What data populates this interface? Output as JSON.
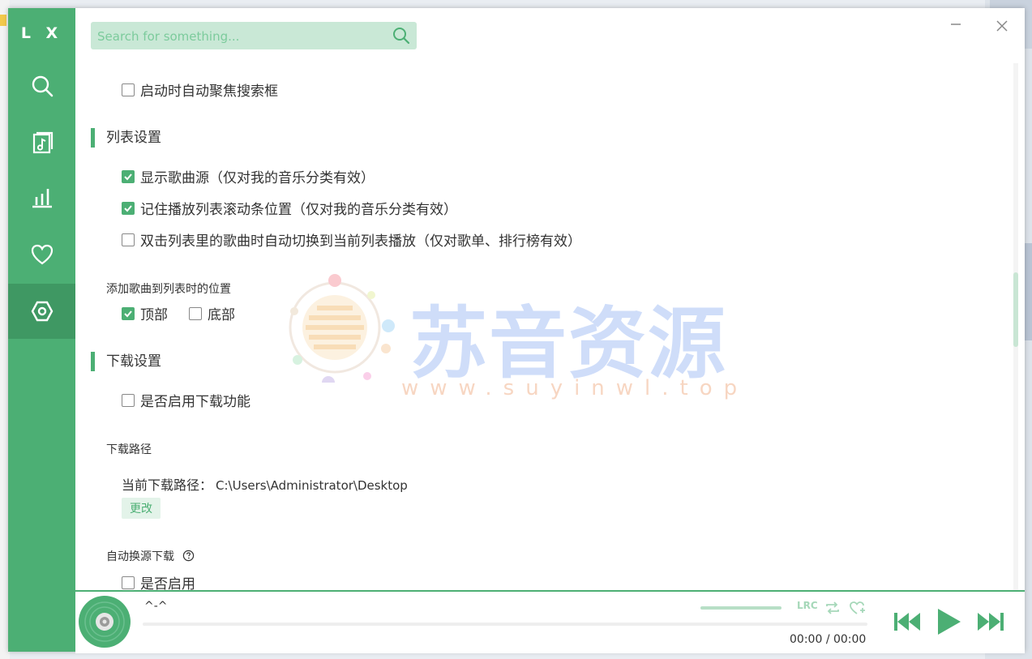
{
  "app": {
    "logo": "L X"
  },
  "sidebar": {
    "items": [
      {
        "name": "search",
        "icon": "search-icon"
      },
      {
        "name": "songlist",
        "icon": "music-file-icon"
      },
      {
        "name": "leaderboard",
        "icon": "bar-chart-icon"
      },
      {
        "name": "my-music",
        "icon": "heart-icon"
      },
      {
        "name": "settings",
        "icon": "hexagon-settings-icon",
        "active": true
      }
    ]
  },
  "search": {
    "placeholder": "Search for something..."
  },
  "settings": {
    "autofocus_search": {
      "label": "启动时自动聚焦搜索框",
      "checked": false
    },
    "list_section_title": "列表设置",
    "list_options": [
      {
        "label": "显示歌曲源（仅对我的音乐分类有效）",
        "checked": true
      },
      {
        "label": "记住播放列表滚动条位置（仅对我的音乐分类有效）",
        "checked": true
      },
      {
        "label": "双击列表里的歌曲时自动切换到当前列表播放（仅对歌单、排行榜有效）",
        "checked": false
      }
    ],
    "add_position_title": "添加歌曲到列表时的位置",
    "add_position_options": [
      {
        "label": "顶部",
        "checked": true
      },
      {
        "label": "底部",
        "checked": false
      }
    ],
    "download_section_title": "下载设置",
    "enable_download": {
      "label": "是否启用下载功能",
      "checked": false
    },
    "download_path_title": "下载路径",
    "current_path_label": "当前下载路径：",
    "current_path_value": "C:\\Users\\Administrator\\Desktop",
    "change_button": "更改",
    "auto_switch_title": "自动换源下载",
    "auto_switch_enable": {
      "label": "是否启用",
      "checked": false
    }
  },
  "watermark": {
    "text": "苏音资源",
    "url": "www.suyinwl.top"
  },
  "player": {
    "title": "^-^",
    "time_current": "00:00",
    "time_separator": "/",
    "time_total": "00:00",
    "progress": 0,
    "volume": 1.0,
    "lyric_button": "LRC"
  },
  "colors": {
    "accent": "#4caf74",
    "accent_dark": "#3f9863",
    "accent_light": "#c9e8d6"
  }
}
